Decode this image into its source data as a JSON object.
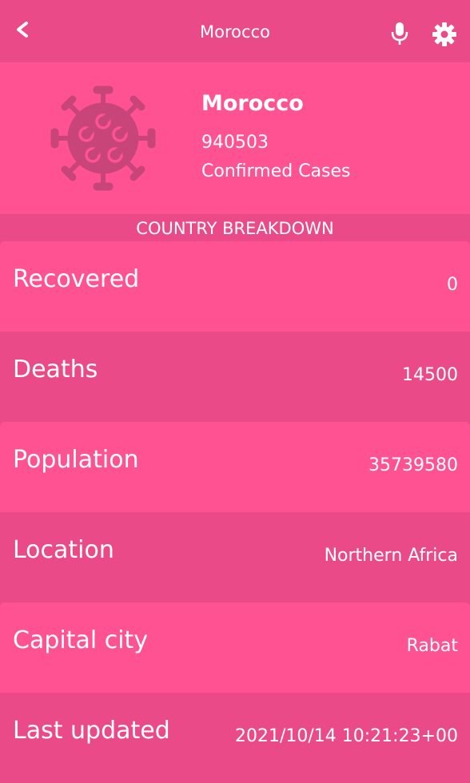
{
  "topbar": {
    "title": "Morocco",
    "back_icon": "chevron-left-icon",
    "mic_icon": "microphone-icon",
    "settings_icon": "gear-icon"
  },
  "header": {
    "country": "Morocco",
    "confirmed_count": "940503",
    "confirmed_label": "Confirmed Cases",
    "icon": "virus-icon"
  },
  "section": {
    "title": "COUNTRY BREAKDOWN"
  },
  "breakdown": [
    {
      "label": "Recovered",
      "value": "0"
    },
    {
      "label": "Deaths",
      "value": "14500"
    },
    {
      "label": "Population",
      "value": "35739580"
    },
    {
      "label": "Location",
      "value": "Northern Africa"
    },
    {
      "label": "Capital city",
      "value": "Rabat"
    },
    {
      "label": "Last updated",
      "value": "2021/10/14 10:21:23+00"
    }
  ],
  "colors": {
    "bar": "#ea4b88",
    "card": "#ff5293",
    "icon_tint": "#c8457a",
    "text": "#ffffff"
  }
}
